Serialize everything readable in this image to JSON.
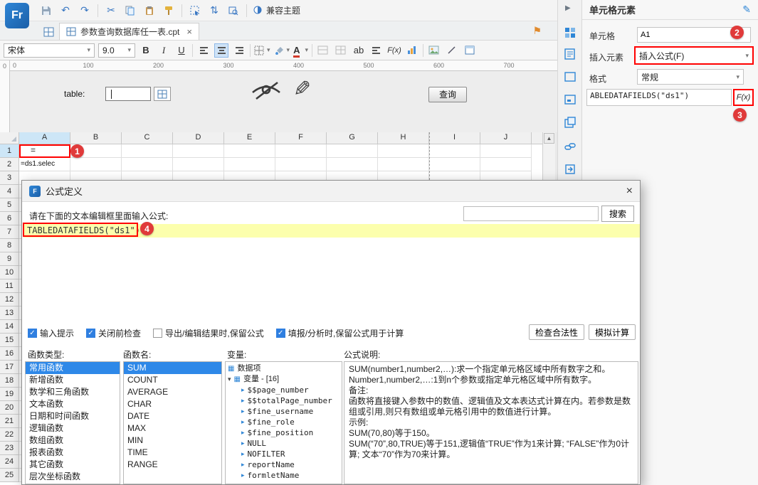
{
  "colors": {
    "accent": "#2f86d6",
    "selection": "#2e88e8",
    "annotation": "#ff0000",
    "formula_highlight": "#fcffad",
    "header_selected": "#cde6f7"
  },
  "icons": {
    "undo": "↶",
    "redo": "↷",
    "cut": "✂",
    "flag": "⚑",
    "close_tab": "×",
    "caret_down": "▾",
    "pencil": "✎",
    "panel_edit": "✎",
    "collapse": "▶",
    "scroll_up": "▲",
    "check": "✓",
    "tree_leaf": "▸",
    "tree_grid": "▦",
    "tree_caret": "▾",
    "logo_letter": "Fr",
    "dialog_logo": "F"
  },
  "toolbar": {
    "compat_theme": "兼容主题"
  },
  "tabbar": {
    "title": "参数查询数据库任一表.cpt"
  },
  "format_toolbar": {
    "font": "宋体",
    "size": "9.0",
    "bold": "B",
    "italic": "I",
    "underline": "U",
    "ab": "ab",
    "fx": "F(x)",
    "a_color": "A"
  },
  "ruler": {
    "ticks": [
      "0",
      "100",
      "200",
      "300",
      "400",
      "500",
      "600",
      "700"
    ],
    "v_origin": "0"
  },
  "canvas": {
    "table_label": "table:",
    "query_button": "查询"
  },
  "grid": {
    "columns": [
      "A",
      "B",
      "C",
      "D",
      "E",
      "F",
      "G",
      "H",
      "I",
      "J"
    ],
    "rows": [
      "1",
      "2",
      "3",
      "4",
      "5",
      "6",
      "7",
      "8",
      "9",
      "10",
      "11",
      "12",
      "13",
      "14",
      "15",
      "16",
      "17",
      "18",
      "19",
      "20",
      "21",
      "22",
      "23",
      "24",
      "25"
    ],
    "cells": {
      "A1": "=",
      "A2": "=ds1.selec"
    }
  },
  "right_panel": {
    "title": "单元格元素",
    "cell_label": "单元格",
    "cell_value": "A1",
    "insert_label": "插入元素",
    "insert_value": "插入公式(F)",
    "format_label": "格式",
    "format_value": "常规",
    "formula_value": "ABLEDATAFIELDS(\"ds1\")",
    "fx_label": "F(x)"
  },
  "dialog": {
    "title": "公式定义",
    "close": "×",
    "prompt": "请在下面的文本编辑框里面输入公式:",
    "search_value": "",
    "search_button": "搜索",
    "formula_text": "TABLEDATAFIELDS(\"ds1\")",
    "checkboxes": [
      {
        "label": "输入提示",
        "checked": true
      },
      {
        "label": "关闭前检查",
        "checked": true
      },
      {
        "label": "导出/编辑结果时,保留公式",
        "checked": false
      },
      {
        "label": "填报/分析时,保留公式用于计算",
        "checked": true
      }
    ],
    "check_button": "检查合法性",
    "simulate_button": "模拟计算",
    "col_type_label": "函数类型:",
    "col_name_label": "函数名:",
    "col_var_label": "变量:",
    "col_desc_label": "公式说明:",
    "function_types": [
      "常用函数",
      "新增函数",
      "数学和三角函数",
      "文本函数",
      "日期和时间函数",
      "逻辑函数",
      "数组函数",
      "报表函数",
      "其它函数",
      "层次坐标函数"
    ],
    "selected_type": "常用函数",
    "function_names": [
      "SUM",
      "COUNT",
      "AVERAGE",
      "CHAR",
      "DATE",
      "MAX",
      "MIN",
      "TIME",
      "RANGE"
    ],
    "selected_name": "SUM",
    "variables": {
      "root1": "数据项",
      "root2": "变量 - [16]",
      "items": [
        "$$page_number",
        "$$totalPage_number",
        "$fine_username",
        "$fine_role",
        "$fine_position",
        "NULL",
        "NOFILTER",
        "reportName",
        "formletName"
      ]
    },
    "description": "SUM(number1,number2,…):求一个指定单元格区域中所有数字之和。\nNumber1,number2,…:1到n个参数或指定单元格区域中所有数字。\n备注:\n函数将直接键入参数中的数值、逻辑值及文本表达式计算在内。若参数是数组或引用,则只有数组或单元格引用中的数值进行计算。\n示例:\nSUM(70,80)等于150。\nSUM(“70”,80,TRUE)等于151,逻辑值“TRUE”作为1来计算; “FALSE”作为0计算; 文本“70”作为70来计算。"
  },
  "annotations": {
    "step1": "1",
    "step2": "2",
    "step3": "3",
    "step4": "4"
  }
}
